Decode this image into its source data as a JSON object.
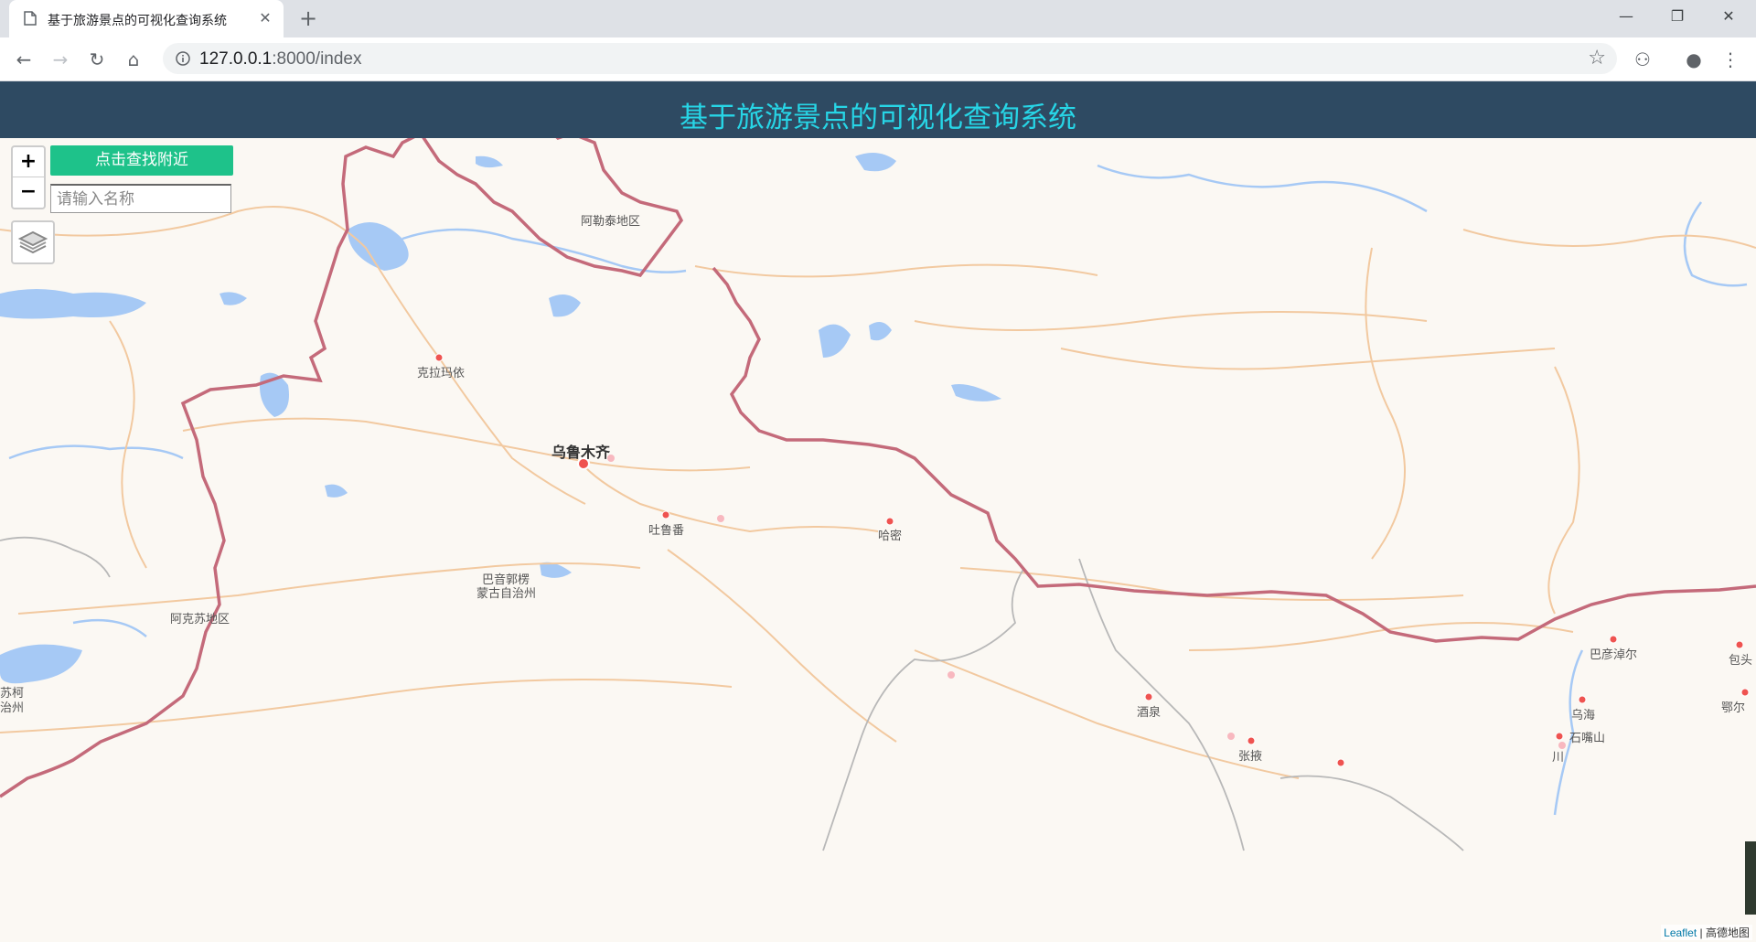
{
  "browser": {
    "tab_title": "基于旅游景点的可视化查询系统",
    "url_host": "127.0.0.1",
    "url_path": ":8000/index",
    "window_controls": {
      "minimize": "—",
      "maximize": "❐",
      "close": "✕"
    }
  },
  "header": {
    "title": "基于旅游景点的可视化查询系统"
  },
  "controls": {
    "zoom_in": "+",
    "zoom_out": "−",
    "nearby_button": "点击查找附近",
    "name_placeholder": "请输入名称"
  },
  "map": {
    "labels": [
      "阿勒泰地区",
      "克拉玛依",
      "乌鲁木齐",
      "吐鲁番",
      "哈密",
      "巴音郭楞",
      "蒙古自治州",
      "阿克苏地区",
      "苏柯",
      "治州",
      "巴彦淖尔",
      "包头",
      "酒泉",
      "乌海",
      "石嘴山",
      "张掖",
      "鄂尔",
      "川"
    ],
    "attribution_link": "Leaflet",
    "attribution_sep": " | ",
    "attribution_provider": "高德地图"
  },
  "colors": {
    "header_bg": "#2e4a62",
    "header_text": "#27d5e6",
    "button_bg": "#1ec28a",
    "map_bg": "#fbf8f3",
    "border": "#c46a7a"
  }
}
